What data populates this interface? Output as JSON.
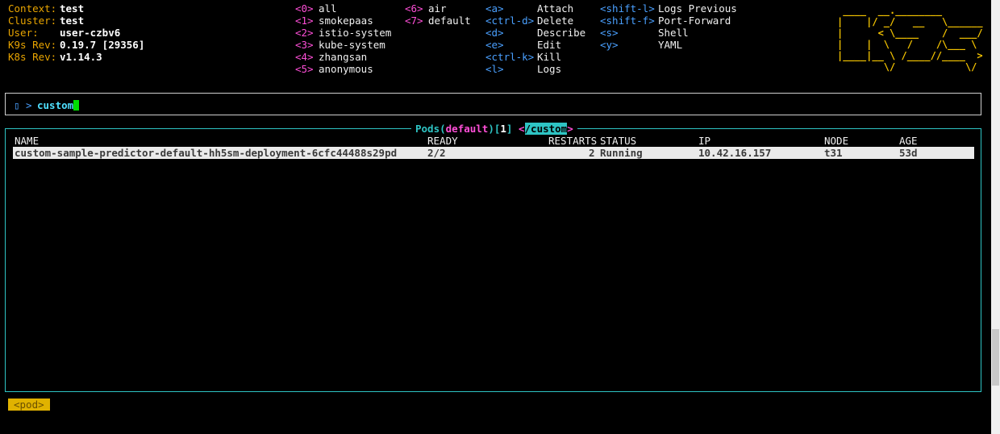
{
  "info": [
    {
      "label": "Context:",
      "value": "test"
    },
    {
      "label": "Cluster:",
      "value": "test"
    },
    {
      "label": "User:",
      "value": "user-czbv6"
    },
    {
      "label": "K9s Rev:",
      "value": "0.19.7 [29356]"
    },
    {
      "label": "K8s Rev:",
      "value": "v1.14.3"
    }
  ],
  "namespaces_col1": [
    {
      "key": "<0>",
      "name": "all"
    },
    {
      "key": "<1>",
      "name": "smokepaas"
    },
    {
      "key": "<2>",
      "name": "istio-system"
    },
    {
      "key": "<3>",
      "name": "kube-system"
    },
    {
      "key": "<4>",
      "name": "zhangsan"
    },
    {
      "key": "<5>",
      "name": "anonymous"
    }
  ],
  "namespaces_col2": [
    {
      "key": "<6>",
      "name": "air"
    },
    {
      "key": "<7>",
      "name": "default"
    }
  ],
  "actions_col1": [
    {
      "key": "<a>",
      "name": "Attach"
    },
    {
      "key": "<ctrl-d>",
      "name": "Delete"
    },
    {
      "key": "<d>",
      "name": "Describe"
    },
    {
      "key": "<e>",
      "name": "Edit"
    },
    {
      "key": "<ctrl-k>",
      "name": "Kill"
    },
    {
      "key": "<l>",
      "name": "Logs"
    }
  ],
  "actions_col2": [
    {
      "key": "<shift-l>",
      "name": "Logs Previous"
    },
    {
      "key": "<shift-f>",
      "name": "Port-Forward"
    },
    {
      "key": "<s>",
      "name": "Shell"
    },
    {
      "key": "<y>",
      "name": "YAML"
    }
  ],
  "logo_lines": [
    " ____  __.________       ",
    "|    |/ _/   __   \\______",
    "|      < \\____    /  ___/",
    "|    |  \\   /    /\\___ \\ ",
    "|____|__ \\ /____//____  >",
    "        \\/            \\/ "
  ],
  "prompt": {
    "icon": "▯",
    "arrow": ">",
    "value": "custom"
  },
  "pods_title": {
    "resource": "Pods",
    "namespace": "default",
    "count": "1",
    "filter": "/custom"
  },
  "table": {
    "headers": [
      "NAME",
      "READY",
      "RESTARTS",
      "STATUS",
      "IP",
      "NODE",
      "AGE"
    ],
    "rows": [
      [
        "custom-sample-predictor-default-hh5sm-deployment-6cfc44488s29pd",
        "2/2",
        "2",
        "Running",
        "10.42.16.157",
        "t31",
        "53d"
      ]
    ]
  },
  "breadcrumb": "<pod>"
}
